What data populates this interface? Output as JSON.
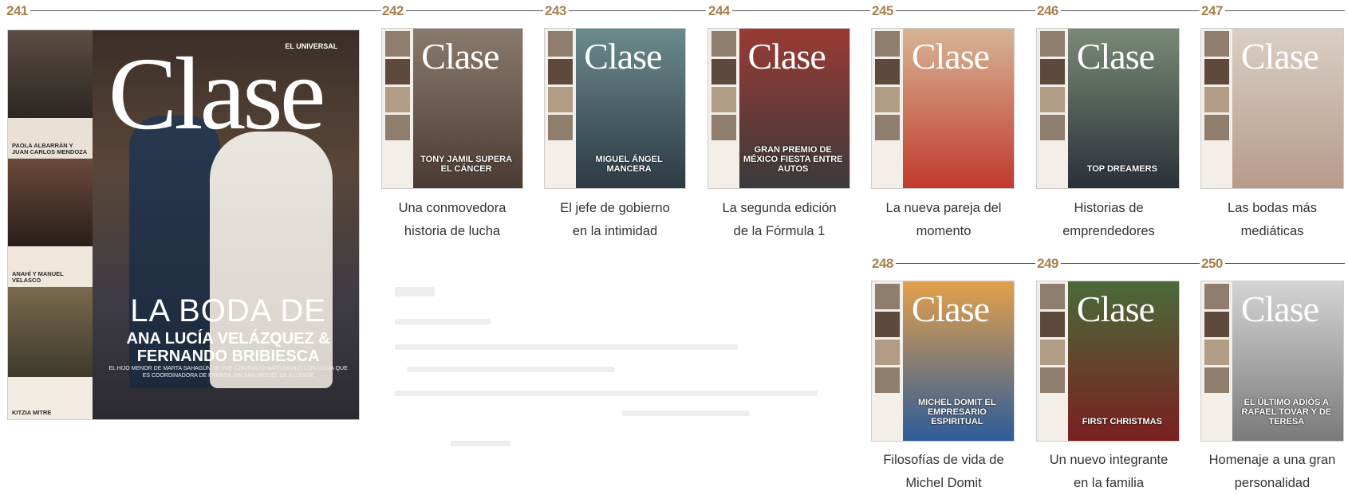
{
  "issues": [
    {
      "number": "241"
    },
    {
      "number": "242",
      "caption_line1": "Una conmovedora",
      "caption_line2": "historia de lucha",
      "cover_logo": "Clase",
      "cover_headline": "TONY JAMIL SUPERA EL CÁNCER",
      "cover_color": "#6e5c50"
    },
    {
      "number": "243",
      "caption_line1": "El jefe de gobierno",
      "caption_line2": "en la intimidad",
      "cover_logo": "Clase",
      "cover_headline": "MIGUEL ÁNGEL MANCERA",
      "cover_color": "#4f6a7d"
    },
    {
      "number": "244",
      "caption_line1": "La segunda edición",
      "caption_line2": "de la Fórmula 1",
      "cover_logo": "Clase",
      "cover_headline": "GRAN PREMIO DE MÉXICO FIESTA ENTRE AUTOS",
      "cover_color": "#3f3b38"
    },
    {
      "number": "245",
      "caption_line1": "La nueva pareja del",
      "caption_line2": "momento",
      "cover_logo": "Clase",
      "cover_headline": "",
      "cover_color": "#c2553f"
    },
    {
      "number": "246",
      "caption_line1": "Historias de",
      "caption_line2": "emprendedores",
      "cover_logo": "Clase",
      "cover_headline": "TOP DREAMERS",
      "cover_color": "#3c4a55"
    },
    {
      "number": "247",
      "caption_line1": "Las bodas más",
      "caption_line2": "mediáticas",
      "cover_logo": "Clase",
      "cover_headline": "",
      "cover_color": "#d8c8b8"
    },
    {
      "number": "248",
      "caption_line1": "Filosofías de vida de",
      "caption_line2": "Michel Domit",
      "cover_logo": "Clase",
      "cover_headline": "MICHEL DOMIT EL EMPRESARIO ESPIRITUAL",
      "cover_color": "#3b6aa3"
    },
    {
      "number": "249",
      "caption_line1": "Un nuevo integrante",
      "caption_line2": "en la familia",
      "cover_logo": "Clase",
      "cover_headline": "FIRST CHRISTMAS",
      "cover_color": "#7a2a2a"
    },
    {
      "number": "250",
      "caption_line1": "Homenaje a una gran",
      "caption_line2": "personalidad",
      "cover_logo": "Clase",
      "cover_headline": "EL ÚLTIMO ADIÓS A RAFAEL TOVAR Y DE TERESA",
      "cover_color": "#b0b0b0"
    }
  ],
  "big_cover": {
    "logo": "Clase",
    "brand": "EL UNIVERSAL",
    "headline_1": "LA BODA DE",
    "headline_2": "ANA LUCÍA VELÁZQUEZ & FERNANDO BRIBIESCA",
    "headline_3": "EL HIJO MENOR DE MARTA SAHAGÚN SE FUE CONTRAJO MATRIMONIO CON LUCÍA QUE ES COORDINADORA DE PRENSA, EN SAN MIGUEL DE ALLENDE",
    "side_panels": [
      {
        "caption": "PAOLA ALBARRÁN Y JUAN CARLOS MENDOZA"
      },
      {
        "caption": "ANAHÍ Y MANUEL VELASCO"
      },
      {
        "caption": "KITZIA MITRE"
      }
    ]
  }
}
